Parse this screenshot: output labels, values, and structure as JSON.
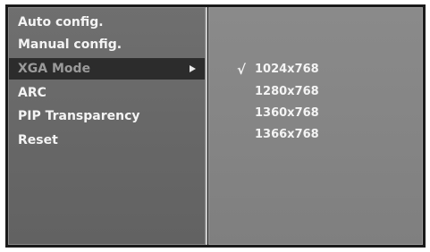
{
  "menu": {
    "items": [
      {
        "label": "Auto config."
      },
      {
        "label": "Manual config."
      },
      {
        "label": "XGA Mode",
        "selected": true,
        "has_submenu": true
      },
      {
        "label": "ARC"
      },
      {
        "label": "PIP Transparency"
      },
      {
        "label": "Reset"
      }
    ]
  },
  "submenu": {
    "check_mark": "√",
    "options": [
      {
        "label": "1024x768",
        "checked": true
      },
      {
        "label": "1280x768"
      },
      {
        "label": "1360x768"
      },
      {
        "label": "1366x768"
      }
    ]
  },
  "colors": {
    "highlight": "#2c2c2c",
    "text": "#f4f4f4",
    "selected_text": "#9a9a9a"
  }
}
